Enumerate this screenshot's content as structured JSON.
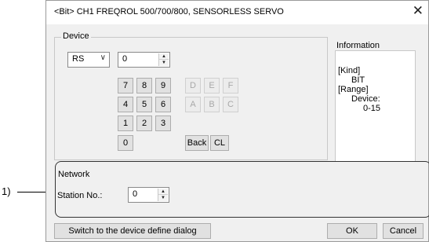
{
  "dialog": {
    "title": "<Bit> CH1 FREQROL 500/700/800, SENSORLESS SERVO",
    "close_glyph": "✕"
  },
  "device": {
    "group_label": "Device",
    "device_type": "RS",
    "device_value": "0",
    "keypad": {
      "digits": [
        "7",
        "8",
        "9",
        "4",
        "5",
        "6",
        "1",
        "2",
        "3",
        "0"
      ],
      "hex": [
        "D",
        "E",
        "F",
        "A",
        "B",
        "C"
      ],
      "back_label": "Back",
      "clear_label": "CL"
    }
  },
  "information": {
    "label": "Information",
    "lines": [
      "[Kind]",
      "BIT",
      "[Range]",
      "Device:",
      "0-15"
    ]
  },
  "network": {
    "group_label": "Network",
    "station_label": "Station No.:",
    "station_value": "0"
  },
  "footer": {
    "switch_label": "Switch to the device define dialog",
    "ok_label": "OK",
    "cancel_label": "Cancel"
  },
  "annotation": {
    "callout_number": "1)"
  }
}
